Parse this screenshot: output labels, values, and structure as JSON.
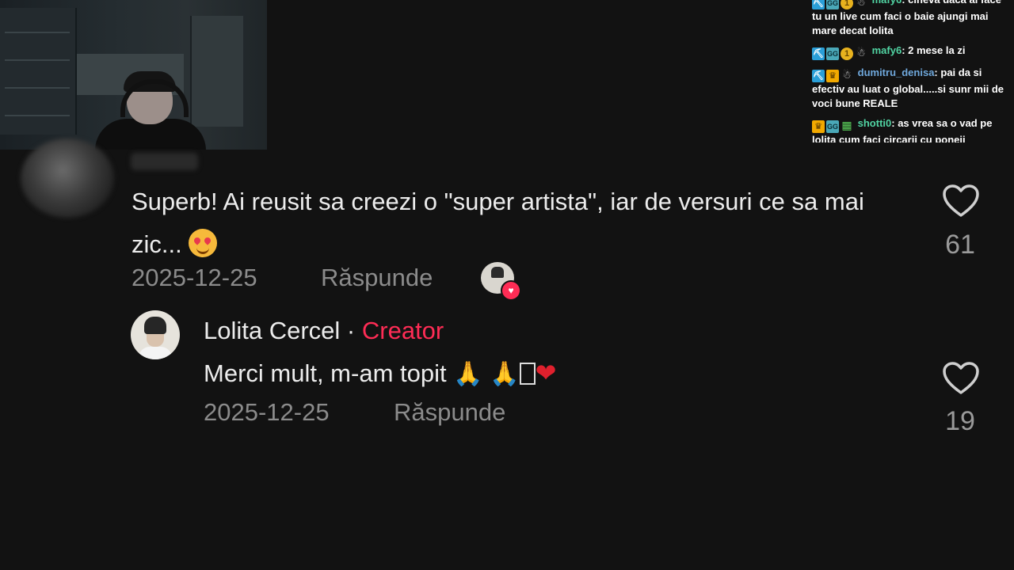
{
  "chat": [
    {
      "user": "mafy6",
      "text": "cineva daca ai face tu un live cum faci o baie ajungi mai mare decat lolita",
      "badges": [
        "pick-icon",
        "g-icon",
        "coin-icon",
        "snow-icon"
      ]
    },
    {
      "user": "mafy6",
      "text": "2 mese la zi",
      "badges": [
        "pick-icon",
        "g-icon",
        "coin-icon",
        "snow-icon"
      ]
    },
    {
      "user": "dumitru_denisa",
      "text": "pai da si efectiv au luat o global.....si sunr mii de voci bune REALE",
      "badges": [
        "pick-icon",
        "crown-icon",
        "snow-icon"
      ]
    },
    {
      "user": "shotti0",
      "text": "as vrea sa o vad pe lolita cum faci circarii cu poneii",
      "badges": [
        "crown-icon",
        "g-icon",
        "gift-icon"
      ]
    }
  ],
  "comment": {
    "text": "Superb! Ai reusit sa creezi o \"super artista\", iar de versuri ce sa mai zic...",
    "date": "2025-12-25",
    "reply_label": "Răspunde",
    "likes": "61"
  },
  "reply": {
    "author": "Lolita Cercel",
    "separator": " · ",
    "creator_label": "Creator",
    "text": "Merci mult, m-am topit",
    "date": "2025-12-25",
    "reply_label": "Răspunde",
    "likes": "19"
  }
}
